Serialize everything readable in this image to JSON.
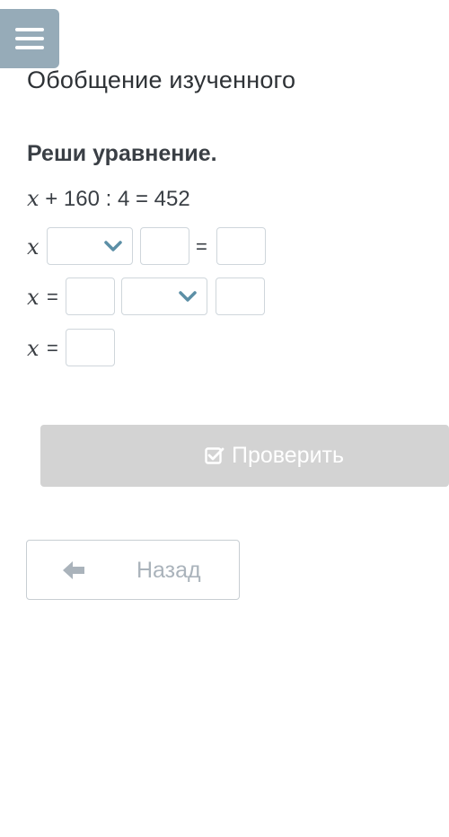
{
  "header": {
    "page_title": "Обобщение изученного"
  },
  "task": {
    "title": "Реши уравнение.",
    "variable": "x",
    "equation_rest": "+ 160 : 4 = 452",
    "rows": [
      {
        "prefix": "x",
        "eq_sign": "="
      },
      {
        "prefix": "x",
        "eq_sign": "="
      },
      {
        "prefix": "x",
        "eq_sign": "="
      }
    ]
  },
  "buttons": {
    "check_label": "Проверить",
    "back_label": "Назад"
  },
  "colors": {
    "menu_bg": "#8ea4b3",
    "chevron": "#5c8fa6",
    "check_bg": "#d3d3d3",
    "back_text": "#aab3bb"
  },
  "icons": {
    "menu": "menu-icon",
    "chevron": "chevron-down-icon",
    "check": "checkbox-icon",
    "back": "arrow-left-icon"
  }
}
